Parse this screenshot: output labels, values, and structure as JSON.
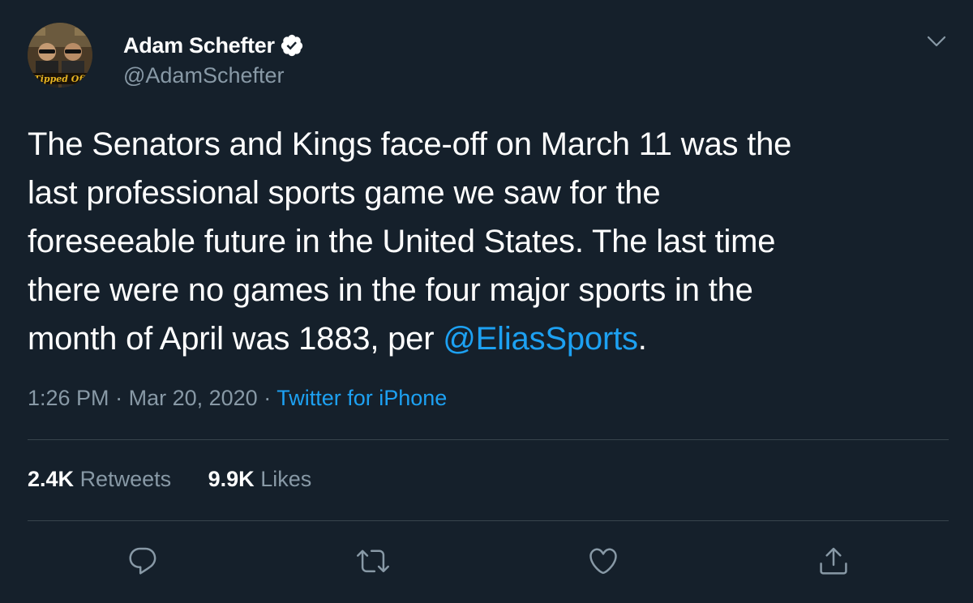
{
  "author": {
    "display_name": "Adam Schefter",
    "handle": "@AdamSchefter",
    "verified": true,
    "avatar_caption": "Tipped Off"
  },
  "tweet": {
    "text_lines": [
      "The Senators and Kings face-off on March 11 was the",
      "last professional sports game we saw for the",
      "foreseeable future in the United States. The last time",
      "there were no games in the four major sports in the",
      "month of April was 1883, per "
    ],
    "mention": "@EliasSports",
    "trailing": "."
  },
  "meta": {
    "time": "1:26 PM",
    "separator": "·",
    "date": "Mar 20, 2020",
    "source": "Twitter for iPhone"
  },
  "stats": {
    "retweets_count": "2.4K",
    "retweets_label": "Retweets",
    "likes_count": "9.9K",
    "likes_label": "Likes"
  },
  "actions": [
    "reply-icon",
    "retweet-icon",
    "like-icon",
    "share-icon"
  ],
  "colors": {
    "background": "#15202b",
    "text": "#ffffff",
    "secondary": "#8899a6",
    "accent": "#1da1f2",
    "divider": "#38444d"
  }
}
